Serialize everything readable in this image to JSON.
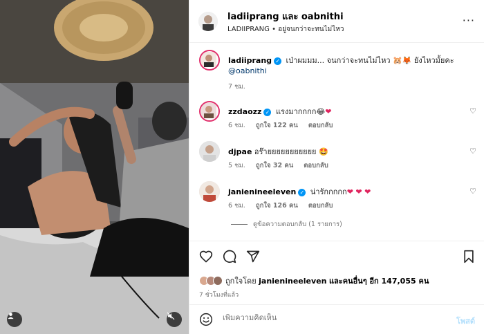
{
  "header": {
    "title": "ladiiprang และ oabnithi",
    "subtitle": "LADIIPRANG • อยู่จนกว่าจะทนไม่ไหว",
    "more_label": "···"
  },
  "caption": {
    "username": "ladiiprang",
    "text": "เป่าผมมม... จนกว่าจะทนไม่ไหว 🐹🦊 ยังไหวมั้ยคะ",
    "mention": "@oabnithi",
    "time": "7 ชม."
  },
  "comments": [
    {
      "username": "zzdaozz",
      "verified": true,
      "text": "แรงมากกกก😂",
      "heart": "❤",
      "time": "6 ชม.",
      "likes": "ถูกใจ 122 คน",
      "reply": "ตอบกลับ"
    },
    {
      "username": "djpae",
      "verified": false,
      "text": "อร๊ายยยยยยยยยยย 🤩",
      "heart": "",
      "time": "5 ชม.",
      "likes": "ถูกใจ 32 คน",
      "reply": "ตอบกลับ"
    },
    {
      "username": "janienineeleven",
      "verified": true,
      "text": "น่ารักกกกก",
      "heart": "❤ ❤ ❤",
      "time": "6 ชม.",
      "likes": "ถูกใจ 126 คน",
      "reply": "ตอบกลับ"
    }
  ],
  "view_replies": "ดูข้อความตอบกลับ (1 รายการ)",
  "likes": {
    "prefix": "ถูกใจโดย",
    "user": "janienineeleven",
    "rest": "และคนอื่นๆ อีก 147,055 คน"
  },
  "post_time": "7 ชั่วโมงที่แล้ว",
  "add_comment": {
    "placeholder": "เพิ่มความคิดเห็น",
    "post_label": "โพสต์"
  },
  "colors": {
    "accent": "#0095f6",
    "story_ring": "#e1306c",
    "heart_red": "#e0245e",
    "post_disabled": "#b2dffc"
  }
}
